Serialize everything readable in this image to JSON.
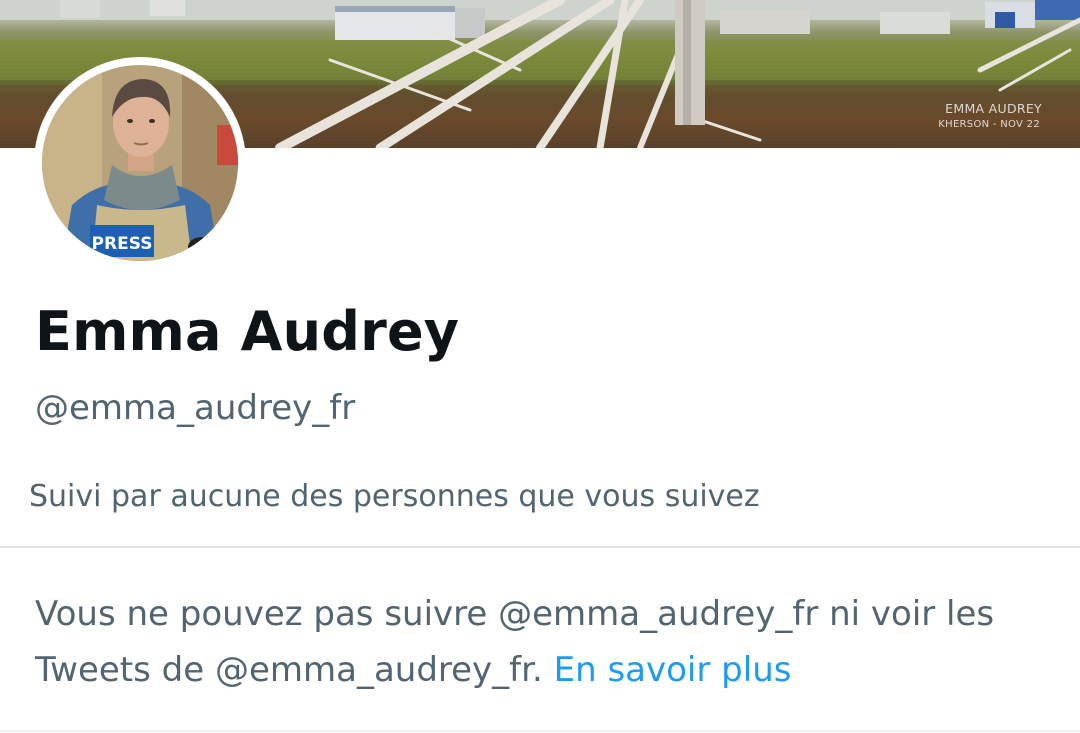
{
  "banner": {
    "watermark_line1": "EMMA AUDREY",
    "watermark_line2": "KHERSON - NOV 22"
  },
  "avatar": {
    "vest_text": "PRESS"
  },
  "profile": {
    "display_name": "Emma Audrey",
    "handle": "@emma_audrey_fr",
    "followed_by": "Suivi par aucune des personnes que vous suivez"
  },
  "notice": {
    "text": "Vous ne pouvez pas suivre @emma_audrey_fr ni voir les Tweets de @emma_audrey_fr.",
    "link_label": "En savoir plus"
  },
  "colors": {
    "primary_text": "#0f1419",
    "secondary_text": "#536471",
    "link": "#1d9bf0"
  }
}
